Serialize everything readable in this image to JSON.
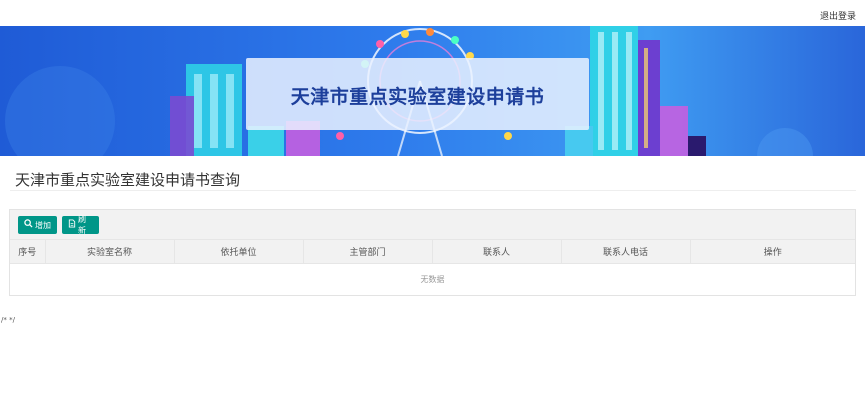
{
  "header": {
    "logout_label": "退出登录"
  },
  "banner": {
    "title": "天津市重点实验室建设申请书"
  },
  "page": {
    "title": "天津市重点实验室建设申请书查询"
  },
  "toolbar": {
    "add_label": "增加",
    "refresh_label": "刷新",
    "add_icon": "search-icon",
    "refresh_icon": "document-icon"
  },
  "table": {
    "columns": [
      "序号",
      "实验室名称",
      "依托单位",
      "主管部门",
      "联系人",
      "联系人电话",
      "操作"
    ],
    "empty_text": "无数据"
  },
  "footer": {
    "code_text": "/* */"
  },
  "colors": {
    "accent": "#009688",
    "banner_title": "#1d3f9b"
  }
}
